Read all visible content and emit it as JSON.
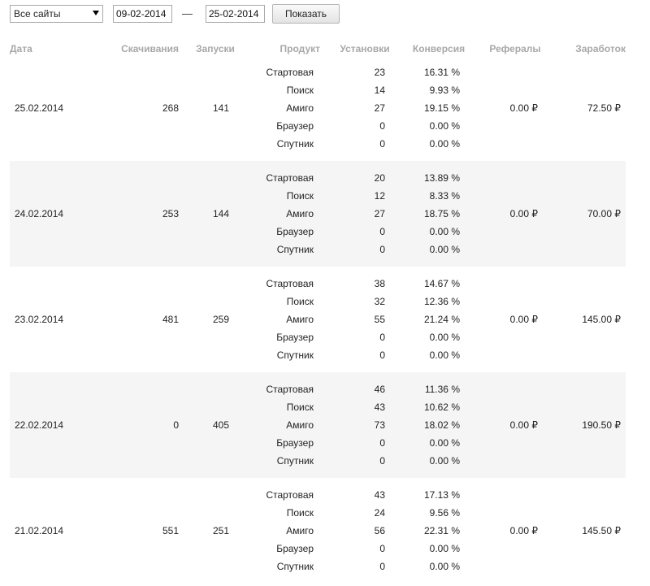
{
  "filters": {
    "site_select": "Все сайты",
    "date_from": "09-02-2014",
    "date_separator": "—",
    "date_to": "25-02-2014",
    "show_button": "Показать"
  },
  "columns": {
    "date": "Дата",
    "downloads": "Скачивания",
    "launches": "Запуски",
    "product": "Продукт",
    "installs": "Установки",
    "conversion": "Конверсия",
    "referrals": "Рефералы",
    "earnings": "Заработок"
  },
  "rows": [
    {
      "date": "25.02.2014",
      "downloads": "268",
      "launches": "141",
      "referrals": "0.00 ₽",
      "earnings": "72.50 ₽",
      "products": [
        {
          "name": "Стартовая",
          "installs": "23",
          "conversion": "16.31 %"
        },
        {
          "name": "Поиск",
          "installs": "14",
          "conversion": "9.93 %"
        },
        {
          "name": "Амиго",
          "installs": "27",
          "conversion": "19.15 %"
        },
        {
          "name": "Браузер",
          "installs": "0",
          "conversion": "0.00 %"
        },
        {
          "name": "Спутник",
          "installs": "0",
          "conversion": "0.00 %"
        }
      ]
    },
    {
      "date": "24.02.2014",
      "downloads": "253",
      "launches": "144",
      "referrals": "0.00 ₽",
      "earnings": "70.00 ₽",
      "products": [
        {
          "name": "Стартовая",
          "installs": "20",
          "conversion": "13.89 %"
        },
        {
          "name": "Поиск",
          "installs": "12",
          "conversion": "8.33 %"
        },
        {
          "name": "Амиго",
          "installs": "27",
          "conversion": "18.75 %"
        },
        {
          "name": "Браузер",
          "installs": "0",
          "conversion": "0.00 %"
        },
        {
          "name": "Спутник",
          "installs": "0",
          "conversion": "0.00 %"
        }
      ]
    },
    {
      "date": "23.02.2014",
      "downloads": "481",
      "launches": "259",
      "referrals": "0.00 ₽",
      "earnings": "145.00 ₽",
      "products": [
        {
          "name": "Стартовая",
          "installs": "38",
          "conversion": "14.67 %"
        },
        {
          "name": "Поиск",
          "installs": "32",
          "conversion": "12.36 %"
        },
        {
          "name": "Амиго",
          "installs": "55",
          "conversion": "21.24 %"
        },
        {
          "name": "Браузер",
          "installs": "0",
          "conversion": "0.00 %"
        },
        {
          "name": "Спутник",
          "installs": "0",
          "conversion": "0.00 %"
        }
      ]
    },
    {
      "date": "22.02.2014",
      "downloads": "0",
      "launches": "405",
      "referrals": "0.00 ₽",
      "earnings": "190.50 ₽",
      "products": [
        {
          "name": "Стартовая",
          "installs": "46",
          "conversion": "11.36 %"
        },
        {
          "name": "Поиск",
          "installs": "43",
          "conversion": "10.62 %"
        },
        {
          "name": "Амиго",
          "installs": "73",
          "conversion": "18.02 %"
        },
        {
          "name": "Браузер",
          "installs": "0",
          "conversion": "0.00 %"
        },
        {
          "name": "Спутник",
          "installs": "0",
          "conversion": "0.00 %"
        }
      ]
    },
    {
      "date": "21.02.2014",
      "downloads": "551",
      "launches": "251",
      "referrals": "0.00 ₽",
      "earnings": "145.50 ₽",
      "products": [
        {
          "name": "Стартовая",
          "installs": "43",
          "conversion": "17.13 %"
        },
        {
          "name": "Поиск",
          "installs": "24",
          "conversion": "9.56 %"
        },
        {
          "name": "Амиго",
          "installs": "56",
          "conversion": "22.31 %"
        },
        {
          "name": "Браузер",
          "installs": "0",
          "conversion": "0.00 %"
        },
        {
          "name": "Спутник",
          "installs": "0",
          "conversion": "0.00 %"
        }
      ]
    }
  ]
}
